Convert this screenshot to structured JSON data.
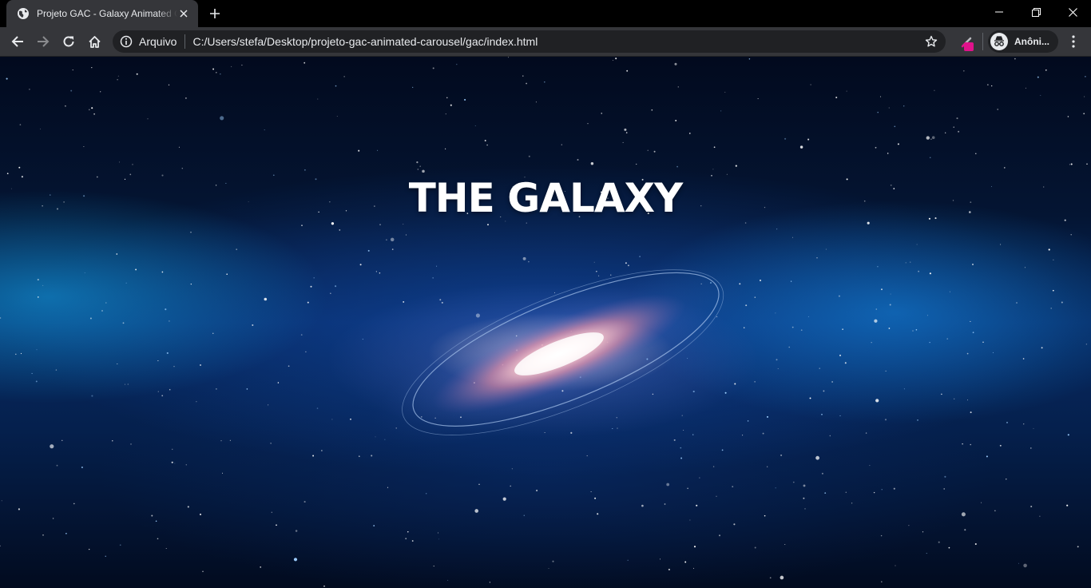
{
  "browser": {
    "tab": {
      "title": "Projeto GAC - Galaxy Animated Carousel"
    },
    "omnibox": {
      "scheme_label": "Arquivo",
      "url": "C:/Users/stefa/Desktop/projeto-gac-animated-carousel/gac/index.html"
    },
    "profile": {
      "label": "Anôni..."
    }
  },
  "page": {
    "headline": "THE GALAXY"
  },
  "icons": {
    "tab_favicon": "globe-icon",
    "tab_close": "close-icon",
    "new_tab": "plus-icon",
    "back": "back-arrow-icon",
    "forward": "forward-arrow-icon",
    "reload": "reload-icon",
    "home": "home-icon",
    "info": "info-icon",
    "bookmark": "star-icon",
    "extension": "pencil-icon",
    "profile": "incognito-icon",
    "menu": "kebab-menu-icon"
  },
  "colors": {
    "chrome_dark": "#35363a",
    "omnibox": "#202124",
    "extension_badge": "#e0128b",
    "space_deep": "#020a1e",
    "space_blue": "#072a63"
  }
}
